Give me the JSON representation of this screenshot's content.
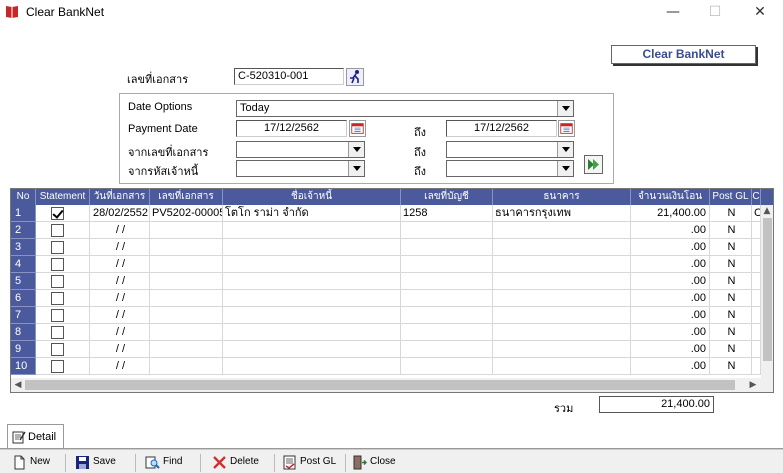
{
  "window": {
    "title": "Clear BankNet",
    "minimize": "—",
    "maximize": "☐",
    "close": "✕"
  },
  "header_box": "Clear BankNet",
  "form": {
    "doc_no_label": "เลขที่เอกสาร",
    "doc_no_value": "C-520310-001",
    "date_options_label": "Date Options",
    "date_options_value": "Today",
    "payment_date_label": "Payment Date",
    "payment_date_from": "17/12/2562",
    "to_label": "ถึง",
    "payment_date_to": "17/12/2562",
    "from_doc_label": "จากเลขที่เอกสาร",
    "from_doc_value": "",
    "to_doc_value": "",
    "from_creditor_label": "จากรหัสเจ้าหนี้",
    "from_creditor_value": "",
    "to_creditor_value": ""
  },
  "grid": {
    "columns": [
      "No",
      "Statement",
      "วันที่เอกสาร",
      "เลขที่เอกสาร",
      "ชื่อเจ้าหนี้",
      "เลขที่บัญชี",
      "ธนาคาร",
      "จำนวนเงินโอน",
      "Post GL",
      "C"
    ],
    "rows": [
      {
        "no": "1",
        "checked": true,
        "date": "28/02/2552",
        "doc": "PV5202-00005",
        "creditor": "โตโก ราม่า จำกัด",
        "account": "1258",
        "bank": "ธนาคารกรุงเทพ",
        "amount": "21,400.00",
        "post": "N",
        "extra": "C"
      },
      {
        "no": "2",
        "checked": false,
        "date": "/ /",
        "doc": "",
        "creditor": "",
        "account": "",
        "bank": "",
        "amount": ".00",
        "post": "N",
        "extra": ""
      },
      {
        "no": "3",
        "checked": false,
        "date": "/ /",
        "doc": "",
        "creditor": "",
        "account": "",
        "bank": "",
        "amount": ".00",
        "post": "N",
        "extra": ""
      },
      {
        "no": "4",
        "checked": false,
        "date": "/ /",
        "doc": "",
        "creditor": "",
        "account": "",
        "bank": "",
        "amount": ".00",
        "post": "N",
        "extra": ""
      },
      {
        "no": "5",
        "checked": false,
        "date": "/ /",
        "doc": "",
        "creditor": "",
        "account": "",
        "bank": "",
        "amount": ".00",
        "post": "N",
        "extra": ""
      },
      {
        "no": "6",
        "checked": false,
        "date": "/ /",
        "doc": "",
        "creditor": "",
        "account": "",
        "bank": "",
        "amount": ".00",
        "post": "N",
        "extra": ""
      },
      {
        "no": "7",
        "checked": false,
        "date": "/ /",
        "doc": "",
        "creditor": "",
        "account": "",
        "bank": "",
        "amount": ".00",
        "post": "N",
        "extra": ""
      },
      {
        "no": "8",
        "checked": false,
        "date": "/ /",
        "doc": "",
        "creditor": "",
        "account": "",
        "bank": "",
        "amount": ".00",
        "post": "N",
        "extra": ""
      },
      {
        "no": "9",
        "checked": false,
        "date": "/ /",
        "doc": "",
        "creditor": "",
        "account": "",
        "bank": "",
        "amount": ".00",
        "post": "N",
        "extra": ""
      },
      {
        "no": "10",
        "checked": false,
        "date": "/ /",
        "doc": "",
        "creditor": "",
        "account": "",
        "bank": "",
        "amount": ".00",
        "post": "N",
        "extra": ""
      }
    ]
  },
  "total": {
    "label": "รวม",
    "value": "21,400.00"
  },
  "tab": {
    "label": "Detail"
  },
  "toolbar": {
    "new": "New",
    "save": "Save",
    "find": "Find",
    "delete": "Delete",
    "post_gl": "Post GL",
    "close": "Close"
  },
  "colors": {
    "grid_header": "#4a5a9c",
    "title_accent": "#3a4d8f"
  }
}
